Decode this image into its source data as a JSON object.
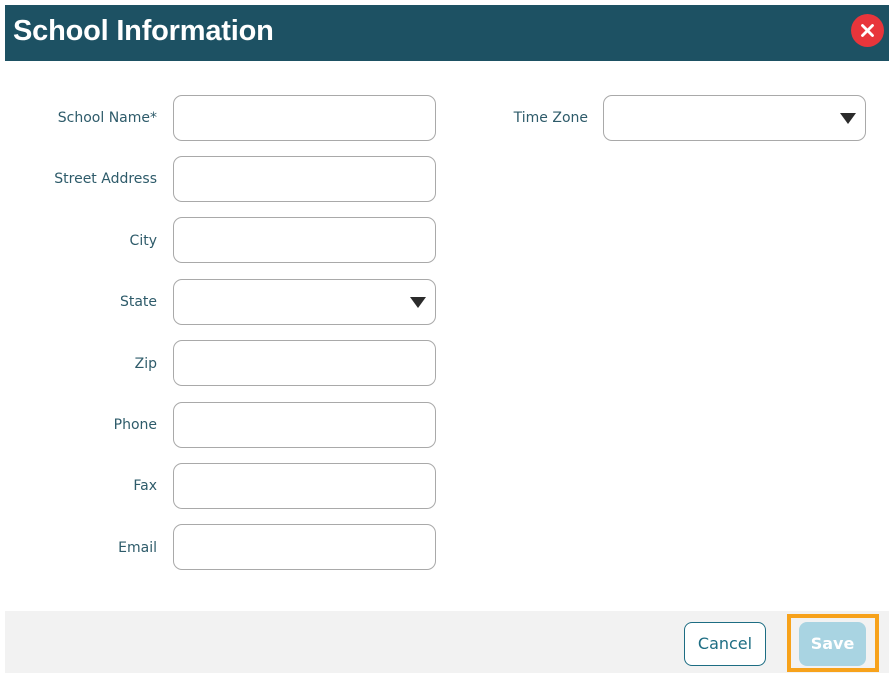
{
  "dialog": {
    "title": "School Information",
    "close_icon": "close-x-icon"
  },
  "form": {
    "left_fields": [
      {
        "label": "School Name*",
        "type": "text",
        "value": "",
        "placeholder": ""
      },
      {
        "label": "Street Address",
        "type": "text",
        "value": "",
        "placeholder": ""
      },
      {
        "label": "City",
        "type": "text",
        "value": "",
        "placeholder": ""
      },
      {
        "label": "State",
        "type": "select",
        "value": ""
      },
      {
        "label": "Zip",
        "type": "text",
        "value": "",
        "placeholder": ""
      },
      {
        "label": "Phone",
        "type": "text",
        "value": "",
        "placeholder": ""
      },
      {
        "label": "Fax",
        "type": "text",
        "value": "",
        "placeholder": ""
      },
      {
        "label": "Email",
        "type": "text",
        "value": "",
        "placeholder": ""
      }
    ],
    "time_zone": {
      "label": "Time Zone",
      "type": "select",
      "value": ""
    }
  },
  "footer": {
    "cancel_label": "Cancel",
    "save_label": "Save"
  },
  "colors": {
    "header_bg": "#1d5163",
    "close_button": "#e8353b",
    "label_text": "#2e5b6a",
    "cancel_border": "#1d6d83",
    "save_disabled_bg": "#a9d4e2",
    "highlight": "#f7a21b"
  }
}
